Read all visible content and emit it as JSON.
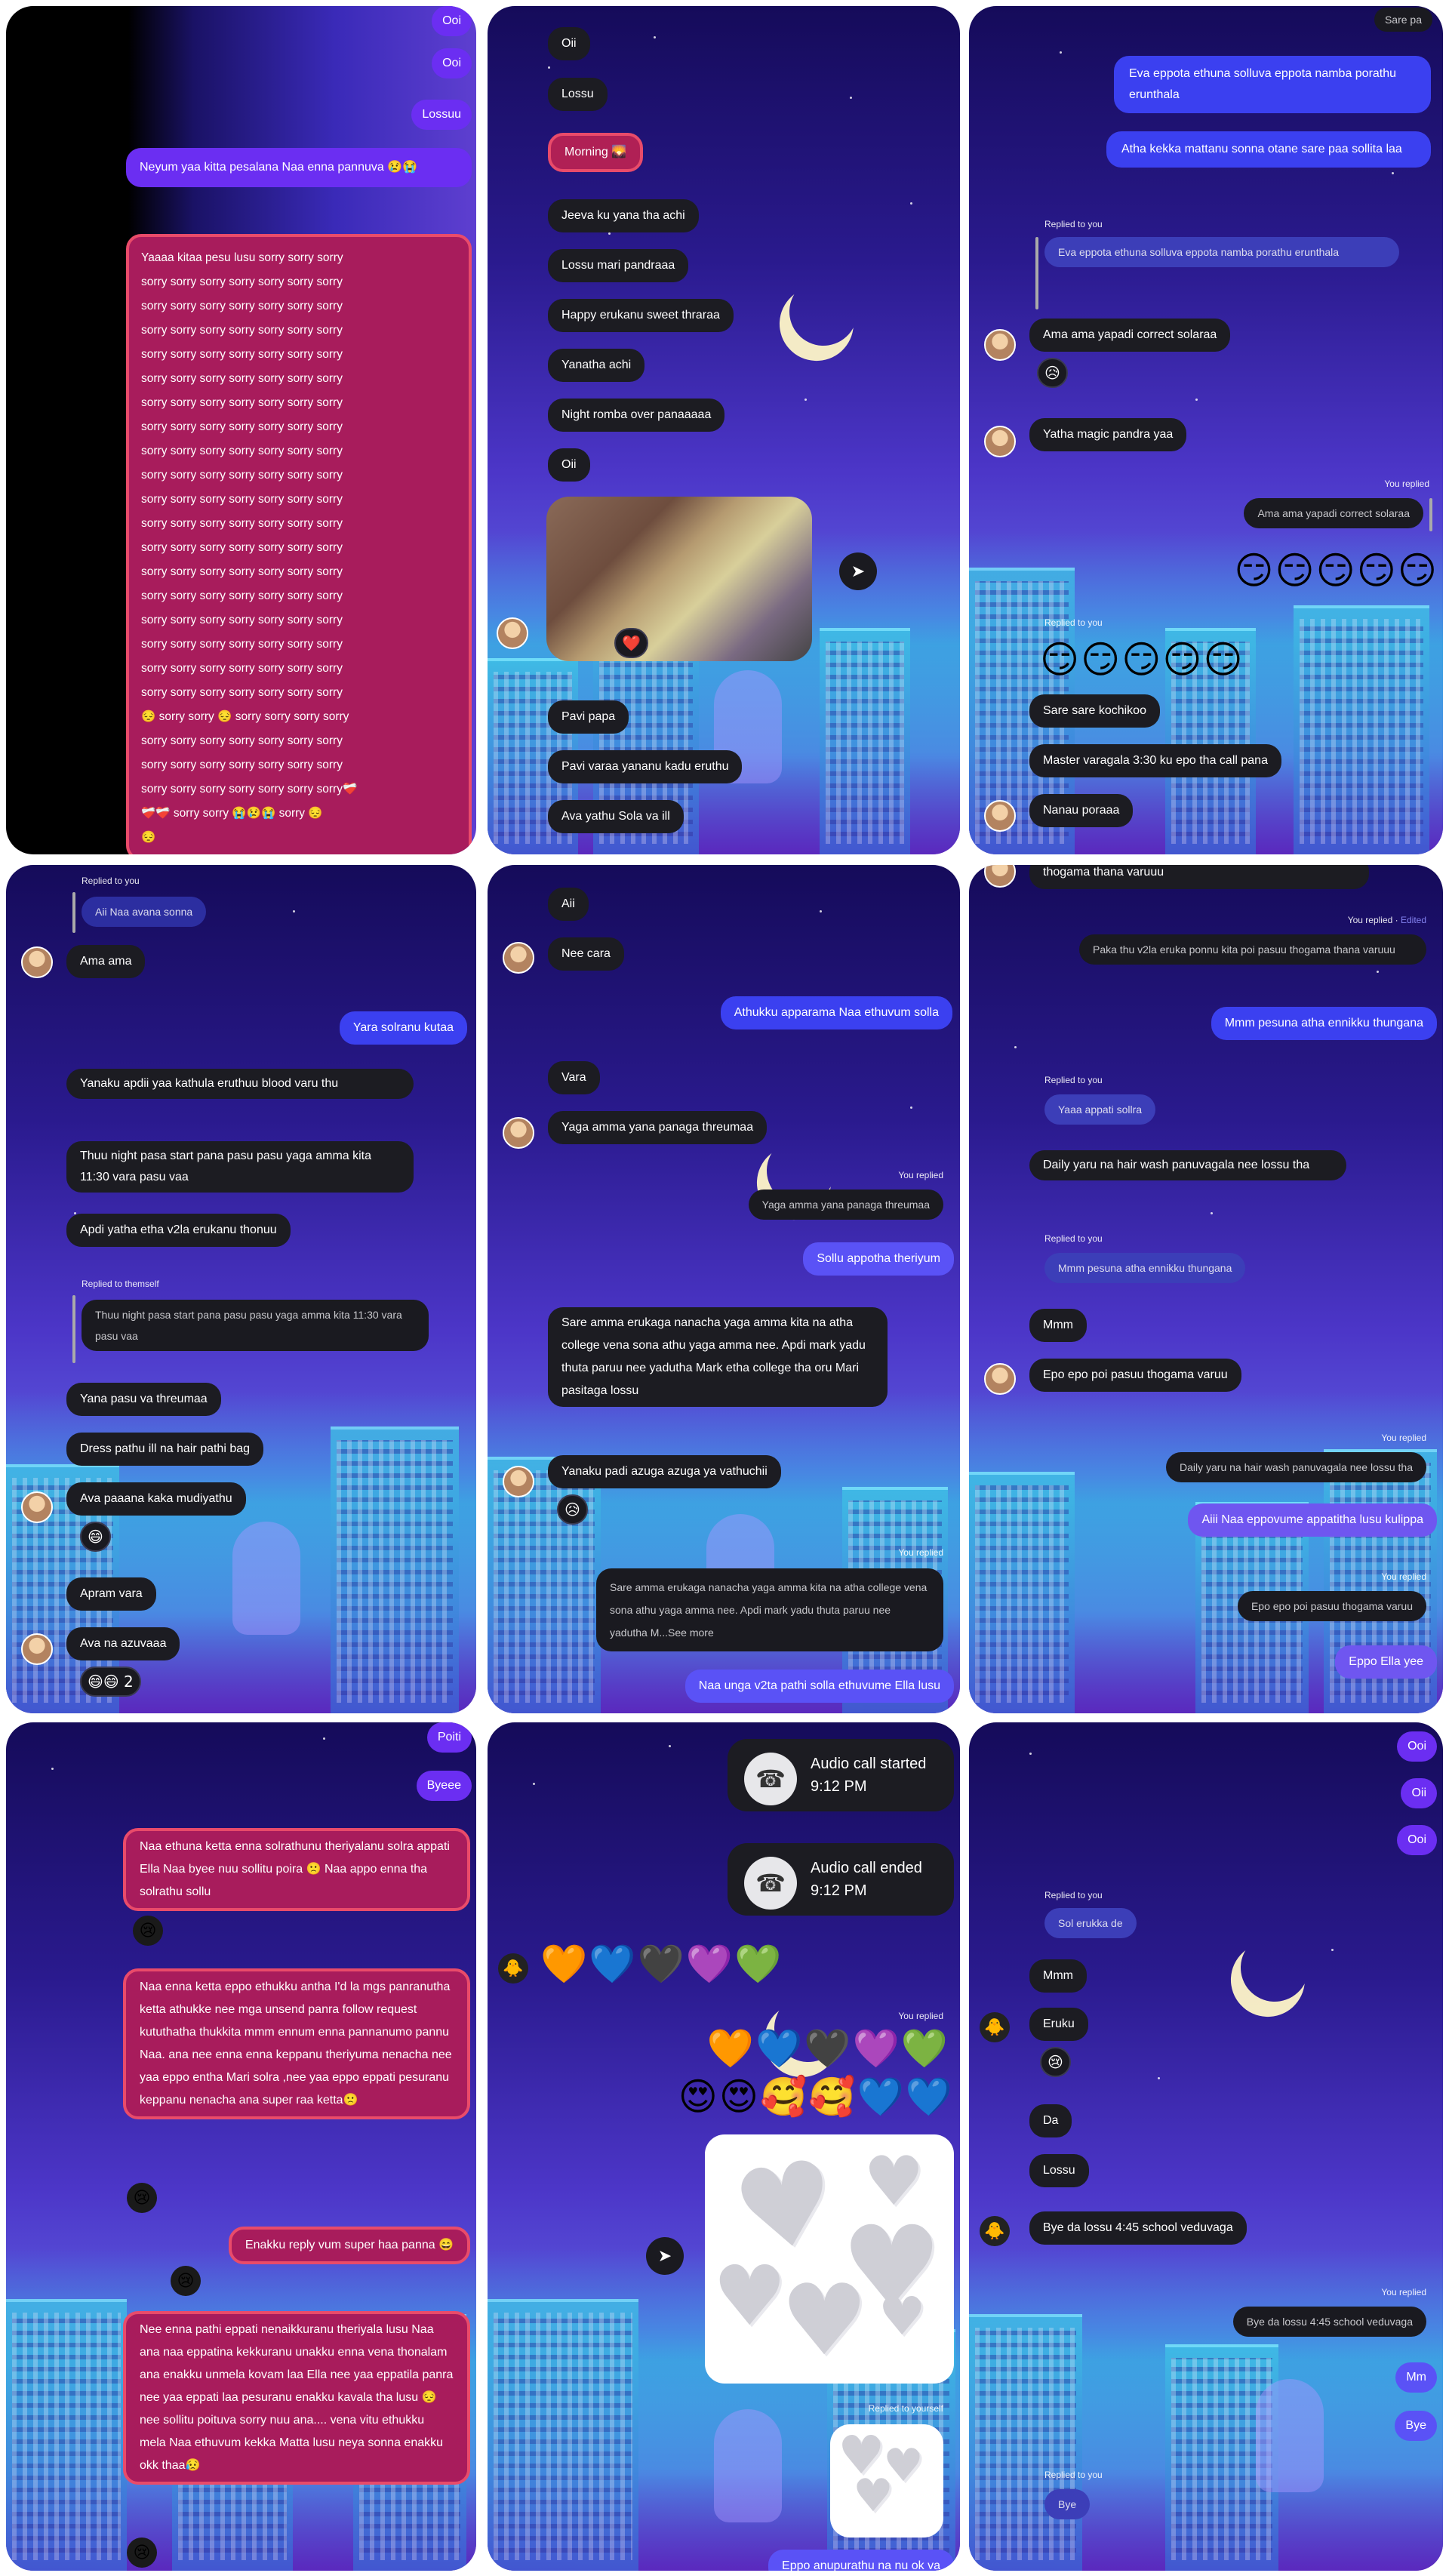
{
  "p1": {
    "bubbles": [
      "Ooi",
      "Ooi",
      "Lossuu",
      "Neyum yaa kitta pesalana Naa enna pannuva 😢😭"
    ],
    "sorry": "Yaaaa kitaa pesu lusu sorry sorry sorry\nsorry sorry sorry sorry sorry sorry sorry\nsorry sorry sorry sorry sorry sorry sorry\nsorry sorry sorry sorry sorry sorry sorry\nsorry sorry sorry sorry sorry sorry sorry\nsorry sorry sorry sorry sorry sorry sorry\nsorry sorry sorry sorry sorry sorry sorry\nsorry sorry sorry sorry sorry sorry sorry\nsorry sorry sorry sorry sorry sorry sorry\nsorry sorry sorry sorry sorry sorry sorry\nsorry sorry sorry sorry sorry sorry sorry\nsorry sorry sorry sorry sorry sorry sorry\nsorry sorry sorry sorry sorry sorry sorry\nsorry sorry sorry sorry sorry sorry sorry\nsorry sorry sorry sorry sorry sorry sorry\nsorry sorry sorry sorry sorry sorry sorry\nsorry sorry sorry sorry sorry sorry sorry\nsorry sorry sorry sorry sorry sorry sorry\nsorry sorry sorry sorry sorry sorry sorry\n😔 sorry sorry 😔 sorry sorry sorry sorry\nsorry sorry sorry sorry sorry sorry sorry\nsorry sorry sorry sorry sorry sorry sorry\nsorry sorry sorry sorry sorry sorry sorry❤️‍🩹\n❤️‍🩹❤️‍🩹 sorry sorry 😭😢😭 sorry 😔\n😔"
  },
  "p2": {
    "bubbles": [
      "Oii",
      "Lossu",
      "Morning 🌄",
      "Jeeva ku yana tha achi",
      "Lossu mari pandraaa",
      "Happy erukanu sweet thraraa",
      "Yanatha achi",
      "Night romba over panaaaaa",
      "Oii",
      "Pavi papa",
      "Pavi varaa yananu kadu eruthu",
      "Ava yathu Sola va ill"
    ],
    "photo_react": "❤️"
  },
  "p3": {
    "top_label": "Sare pa",
    "bubbles": [
      "Eva eppota ethuna solluva eppota namba porathu erunthala",
      "Atha kekka mattanu sonna otane sare paa sollita laa"
    ],
    "replied_to_you": "Replied to you",
    "quote": "Eva eppota ethuna solluva eppota namba porathu erunthala",
    "b2": [
      "Ama ama yapadi correct solaraa",
      "Yatha magic pandra yaa"
    ],
    "react1": "😥",
    "you_replied": "You replied",
    "quote2": "Ama ama yapadi correct solaraa",
    "emoji_row1": "😏😏😏😏😏",
    "replied_to_you2": "Replied to you",
    "emoji_row2": "😏😏😏😏😏",
    "b3": [
      "Sare sare kochikoo",
      "Master varagala 3:30 ku epo tha call pana",
      "Nanau poraaa"
    ]
  },
  "p4": {
    "replied_to_you": "Replied to you",
    "quote": "Aii Naa avana sonna",
    "b1": "Ama ama",
    "b2": "Yara solranu kutaa",
    "b3": [
      "Yanaku apdii yaa kathula eruthuu blood varu thu",
      "Thuu night pasa start pana pasu pasu yaga amma kita 11:30 vara pasu vaa",
      "Apdi yatha etha v2la erukanu thonuu"
    ],
    "replied_to_themself": "Replied to themself",
    "quote2": "Thuu night pasa start pana pasu pasu yaga amma kita 11:30 vara pasu vaa",
    "b4": [
      "Yana pasu va threumaa",
      "Dress pathu ill na hair pathi bag",
      "Ava paaana kaka mudiyathu",
      "Apram vara",
      "Ava na azuvaaa"
    ],
    "react1": "😄",
    "react2": "😄😄 2"
  },
  "p5": {
    "b1": [
      "Aii",
      "Nee cara"
    ],
    "b2": "Athukku apparama Naa ethuvum solla",
    "b3": [
      "Vara",
      "Yaga amma yana panaga threumaa"
    ],
    "you_replied": "You replied",
    "quote1": "Yaga amma yana panaga threumaa",
    "b4": "Sollu appotha theriyum",
    "b5": [
      "Sare amma erukaga nanacha yaga amma kita na atha college vena sona athu yaga amma nee. Apdi mark yadu thuta paruu nee yadutha Mark etha college tha oru Mari pasitaga lossu",
      "Yanaku padi azuga azuga ya vathuchii"
    ],
    "react1": "😥",
    "you_replied2": "You replied",
    "quote2": "Sare amma erukaga nanacha yaga amma kita na atha college vena sona athu yaga amma nee. Apdi mark yadu thuta paruu nee yadutha M...See more",
    "b6": "Naa unga v2ta pathi solla ethuvume Ella lusu"
  },
  "p6": {
    "top": "thogama thana varuuu",
    "you_replied": "You replied",
    "edited": "Edited",
    "quote1": "Paka thu v2la eruka ponnu kita poi pasuu thogama thana varuuu",
    "b1": "Mmm pesuna atha ennikku thungana",
    "replied_to_you": "Replied to you",
    "quote2": "Yaaa appati sollra",
    "b2": "Daily yaru na hair wash panuvagala nee lossu tha",
    "replied_to_you2": "Replied to you",
    "quote3": "Mmm pesuna atha ennikku thungana",
    "b3": [
      "Mmm",
      "Epo epo poi pasuu thogama varuu"
    ],
    "you_replied2": "You replied",
    "quote4": "Daily yaru na hair wash panuvagala nee lossu tha",
    "b4": "Aiii Naa eppovume appatitha lusu kulippa",
    "you_replied3": "You replied",
    "quote5": "Epo epo poi pasuu thogama varuu",
    "b5": "Eppo Ella yee"
  },
  "p7": {
    "b1": [
      "Poiti",
      "Byeee"
    ],
    "pink1": "Naa ethuna ketta enna solrathunu theriyalanu solra appati Ella Naa byee nuu sollitu poira 🙁 Naa appo enna tha solrathu sollu",
    "r1": "😢",
    "pink2": "Naa enna ketta eppo ethukku antha I'd la mgs panranutha ketta athukke nee mga unsend panra follow request kututhatha thukkita mmm ennum enna pannanumo pannu Naa. ana nee enna enna keppanu theriyuma nenacha nee yaa eppo entha Mari solra ,nee yaa eppo eppati pesuranu keppanu nenacha ana super raa ketta🙁",
    "r2": "😢",
    "pink3": "Enakku reply vum super haa panna 😄",
    "r3": "😢",
    "pink4": "Nee enna pathi eppati nenaikkuranu theriyala lusu Naa ana naa eppatina kekkuranu unakku enna vena thonalam ana enakku unmela kovam laa Ella nee yaa eppatila panra nee yaa eppati laa pesuranu enakku kavala tha lusu 😔 nee sollitu poituva sorry nuu ana.... vena vitu ethukku mela Naa ethuvum kekka Matta lusu neya sonna enakku okk thaa😥",
    "r4": "😢"
  },
  "p8": {
    "call1_title": "Audio call started",
    "call1_time": "9:12 PM",
    "call2_title": "Audio call ended",
    "call2_time": "9:12 PM",
    "hearts1": "🧡💙🖤💜💚",
    "you_replied": "You replied",
    "hearts2": "🧡💙🖤💜💚",
    "hearts3": "😍😍🥰🥰💙💙",
    "replied_to_yourself": "Replied to yourself",
    "b1": "Eppo anupurathu na nu ok va"
  },
  "p9": {
    "b1": [
      "Ooi",
      "Oii",
      "Ooi"
    ],
    "replied_to_you": "Replied to you",
    "quote1": "Sol erukka de",
    "b2": [
      "Mmm",
      "Eruku"
    ],
    "react1": "😢",
    "b3": [
      "Da",
      "Lossu",
      "Bye da lossu 4:45 school veduvaga"
    ],
    "you_replied": "You replied",
    "quote2": "Bye da lossu 4:45 school veduvaga",
    "b4": [
      "Mm",
      "Bye"
    ],
    "replied_to_you2": "Replied to you",
    "b5": "Bye"
  },
  "colors": {
    "outgoing": "#6b2ef2",
    "outgoing_blue": "#3b40f0",
    "incoming": "#1c1c22",
    "pink": "#a81c5c"
  }
}
